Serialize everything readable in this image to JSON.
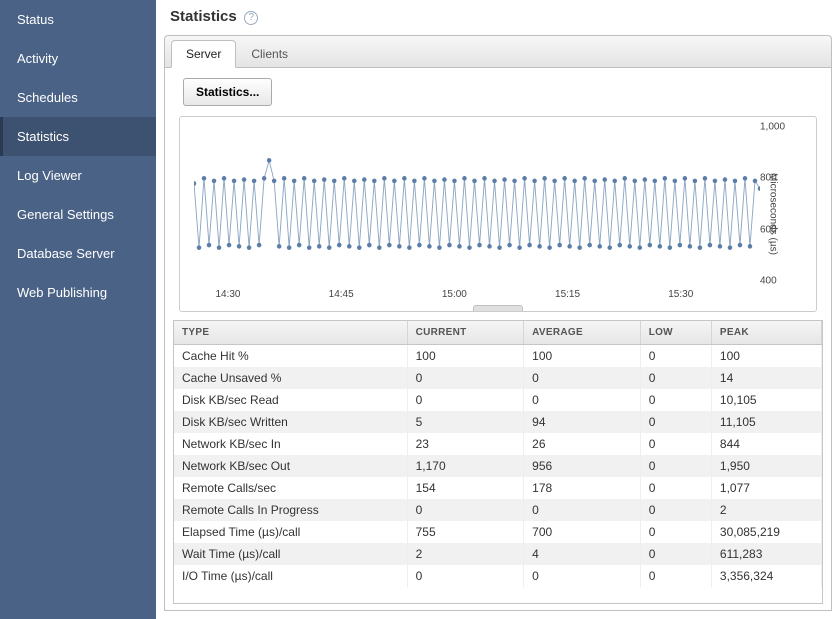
{
  "sidebar": {
    "items": [
      {
        "label": "Status"
      },
      {
        "label": "Activity"
      },
      {
        "label": "Schedules"
      },
      {
        "label": "Statistics"
      },
      {
        "label": "Log Viewer"
      },
      {
        "label": "General Settings"
      },
      {
        "label": "Database Server"
      },
      {
        "label": "Web Publishing"
      }
    ],
    "activeIndex": 3
  },
  "page": {
    "title": "Statistics"
  },
  "tabs": {
    "items": [
      {
        "label": "Server"
      },
      {
        "label": "Clients"
      }
    ],
    "activeIndex": 0
  },
  "toolbar": {
    "stats_button": "Statistics..."
  },
  "chart_data": {
    "type": "line",
    "ylabel": "Microseconds (µs)",
    "ylim": [
      400,
      1000
    ],
    "yticks": [
      400,
      600,
      800,
      1000
    ],
    "xticks": [
      "14:30",
      "14:45",
      "15:00",
      "15:15",
      "15:30"
    ],
    "series": [
      {
        "name": "Elapsed Time (µs)/call",
        "values": [
          780,
          530,
          800,
          540,
          790,
          530,
          800,
          540,
          790,
          535,
          795,
          530,
          790,
          540,
          800,
          870,
          790,
          535,
          800,
          530,
          790,
          540,
          800,
          530,
          790,
          535,
          795,
          530,
          790,
          540,
          800,
          535,
          790,
          530,
          795,
          540,
          790,
          530,
          800,
          540,
          790,
          535,
          800,
          530,
          790,
          540,
          800,
          535,
          790,
          530,
          795,
          540,
          790,
          535,
          800,
          530,
          790,
          540,
          800,
          535,
          790,
          530,
          795,
          540,
          790,
          530,
          800,
          540,
          790,
          535,
          800,
          530,
          790,
          540,
          800,
          535,
          790,
          530,
          800,
          540,
          790,
          535,
          795,
          530,
          790,
          540,
          800,
          535,
          790,
          530,
          795,
          540,
          790,
          535,
          800,
          530,
          790,
          540,
          800,
          535,
          790,
          530,
          800,
          540,
          790,
          535,
          795,
          530,
          790,
          540,
          800,
          535,
          790,
          760
        ]
      }
    ]
  },
  "table": {
    "columns": [
      "TYPE",
      "CURRENT",
      "AVERAGE",
      "LOW",
      "PEAK"
    ],
    "colWidths": [
      "36%",
      "18%",
      "18%",
      "11%",
      "17%"
    ],
    "rows": [
      {
        "type": "Cache Hit %",
        "current": "100",
        "average": "100",
        "low": "0",
        "peak": "100"
      },
      {
        "type": "Cache Unsaved %",
        "current": "0",
        "average": "0",
        "low": "0",
        "peak": "14"
      },
      {
        "type": "Disk KB/sec Read",
        "current": "0",
        "average": "0",
        "low": "0",
        "peak": "10,105"
      },
      {
        "type": "Disk KB/sec Written",
        "current": "5",
        "average": "94",
        "low": "0",
        "peak": "11,105"
      },
      {
        "type": "Network KB/sec In",
        "current": "23",
        "average": "26",
        "low": "0",
        "peak": "844"
      },
      {
        "type": "Network KB/sec Out",
        "current": "1,170",
        "average": "956",
        "low": "0",
        "peak": "1,950"
      },
      {
        "type": "Remote Calls/sec",
        "current": "154",
        "average": "178",
        "low": "0",
        "peak": "1,077"
      },
      {
        "type": "Remote Calls In Progress",
        "current": "0",
        "average": "0",
        "low": "0",
        "peak": "2"
      },
      {
        "type": "Elapsed Time (µs)/call",
        "current": "755",
        "average": "700",
        "low": "0",
        "peak": "30,085,219"
      },
      {
        "type": "Wait Time (µs)/call",
        "current": "2",
        "average": "4",
        "low": "0",
        "peak": "611,283"
      },
      {
        "type": "I/O Time (µs)/call",
        "current": "0",
        "average": "0",
        "low": "0",
        "peak": "3,356,324"
      }
    ]
  }
}
